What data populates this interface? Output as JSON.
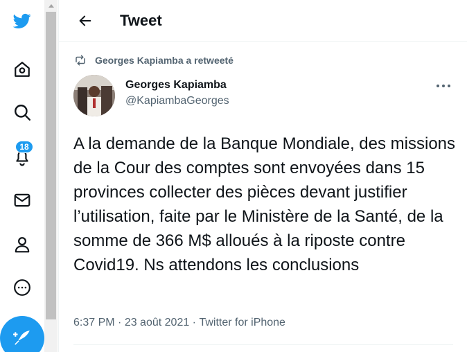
{
  "header": {
    "title": "Tweet"
  },
  "notifications": {
    "count": "18"
  },
  "retweet": {
    "label": "Georges Kapiamba a retweeté"
  },
  "tweet": {
    "author_name": "Georges Kapiamba",
    "author_handle": "@KapiambaGeorges",
    "text": "A la demande de la Banque Mondiale, des missions de la Cour des comptes sont envoyées dans 15 provinces collecter des pièces devant justifier l’utilisation, faite par le Ministère de la Santé, de la somme de 366 M$ alloués à la riposte contre Covid19. Ns attendons les conclusions",
    "time": "6:37 PM",
    "date": "23 août 2021",
    "source": "Twitter for iPhone",
    "separator": " · "
  },
  "colors": {
    "accent": "#1d9bf0",
    "text": "#0f1419",
    "secondary": "#536471"
  },
  "icons": [
    "twitter-logo-icon",
    "home-icon",
    "explore-icon",
    "notifications-icon",
    "messages-icon",
    "profile-icon",
    "more-icon",
    "compose-icon",
    "back-arrow-icon",
    "retweet-icon",
    "ellipsis-icon"
  ]
}
